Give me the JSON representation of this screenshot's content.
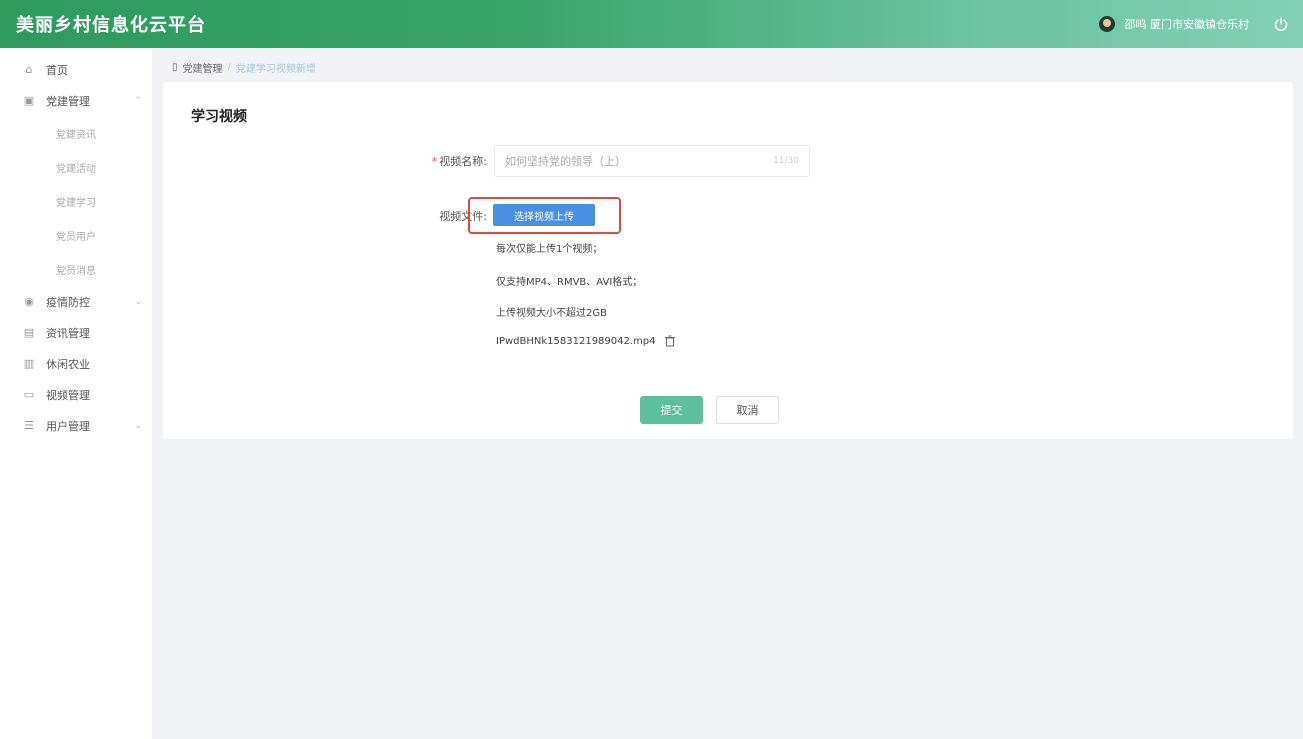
{
  "app": {
    "title": "美丽乡村信息化云平台",
    "user_name": "邵鸣 厦门市安徽镇仓乐村"
  },
  "sidebar": {
    "items": [
      {
        "label": "首页",
        "icon": "home-icon"
      },
      {
        "label": "党建管理",
        "icon": "party-icon",
        "expanded": true,
        "children": [
          "党建资讯",
          "党建活动",
          "党建学习",
          "党员用户",
          "党员消息"
        ]
      },
      {
        "label": "疫情防控",
        "icon": "shield-icon"
      },
      {
        "label": "资讯管理",
        "icon": "news-icon"
      },
      {
        "label": "休闲农业",
        "icon": "leaf-icon"
      },
      {
        "label": "视频管理",
        "icon": "video-icon"
      },
      {
        "label": "用户管理",
        "icon": "user-icon"
      }
    ]
  },
  "breadcrumb": {
    "parent": "党建管理",
    "current": "党建学习视频新增"
  },
  "card": {
    "title": "学习视频"
  },
  "form": {
    "name_label": "视频名称:",
    "name_value": "如何坚持党的领导（上）",
    "name_count": "11/30",
    "file_label": "视频文件:",
    "upload_button": "选择视频上传",
    "tips": [
      "每次仅能上传1个视频；",
      "仅支持MP4、RMVB、AVI格式；",
      "上传视频大小不超过2GB"
    ],
    "file_name": "IPwdBHNk1583121989042.mp4"
  },
  "actions": {
    "submit": "提交",
    "cancel": "取消"
  },
  "colors": {
    "primary": "#5bc09b",
    "upload": "#4a8fe3",
    "highlight": "#e04b3c"
  }
}
